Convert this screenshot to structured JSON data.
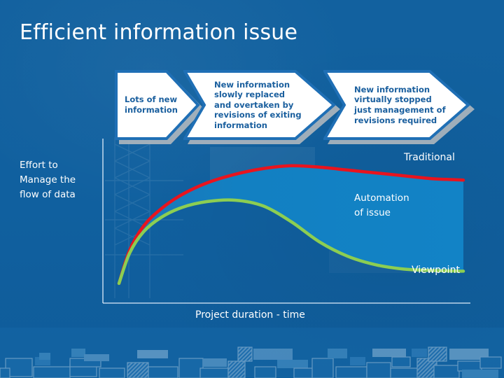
{
  "slide": {
    "title": "Efficient information issue",
    "background_color": "#11609f",
    "fill_color": "#1380c0"
  },
  "process": {
    "steps": [
      {
        "label": "Lots of new\ninformation"
      },
      {
        "label": "New information\nslowly replaced\nand overtaken by\nrevisions of exiting\ninformation"
      },
      {
        "label": "New information\nvirtually stopped\njust management of\nrevisions required"
      }
    ]
  },
  "chart_data": {
    "type": "line",
    "title": "Efficient information issue",
    "xlabel": "Project duration - time",
    "ylabel": "Effort to\nManage the\nflow of data",
    "xlim": [
      0,
      10
    ],
    "ylim": [
      0,
      10
    ],
    "grid": false,
    "legend_position": "inline-annotations",
    "annotations": [
      {
        "text": "Traditional",
        "series": "Traditional",
        "color": "#e8141e"
      },
      {
        "text": "Viewpoint",
        "series": "Viewpoint",
        "color": "#8cce52"
      },
      {
        "text": "Automation\nof issue",
        "series": "fill-between",
        "color": "#1380c0"
      }
    ],
    "series": [
      {
        "name": "Traditional",
        "color": "#e8141e",
        "x": [
          0.1,
          0.4,
          0.8,
          1.3,
          1.9,
          2.6,
          3.4,
          4.2,
          5.0,
          5.8,
          6.6,
          7.4,
          8.2,
          9.0,
          9.9
        ],
        "y": [
          0.3,
          2.6,
          4.3,
          5.5,
          6.5,
          7.3,
          7.9,
          8.3,
          8.5,
          8.4,
          8.2,
          8.0,
          7.8,
          7.6,
          7.5
        ]
      },
      {
        "name": "Viewpoint",
        "color": "#8cce52",
        "x": [
          0.1,
          0.4,
          0.8,
          1.3,
          1.9,
          2.6,
          3.4,
          4.2,
          5.0,
          5.8,
          6.6,
          7.4,
          8.2,
          9.0,
          9.9
        ],
        "y": [
          0.3,
          2.4,
          3.9,
          4.9,
          5.6,
          6.0,
          6.1,
          5.7,
          4.6,
          3.2,
          2.2,
          1.6,
          1.3,
          1.2,
          1.15
        ]
      }
    ]
  },
  "axis_labels": {
    "y_axis": "Effort to\nManage the\nflow of data",
    "x_axis": "Project duration - time",
    "traditional": "Traditional",
    "automation": "Automation\nof issue",
    "viewpoint": "Viewpoint"
  }
}
